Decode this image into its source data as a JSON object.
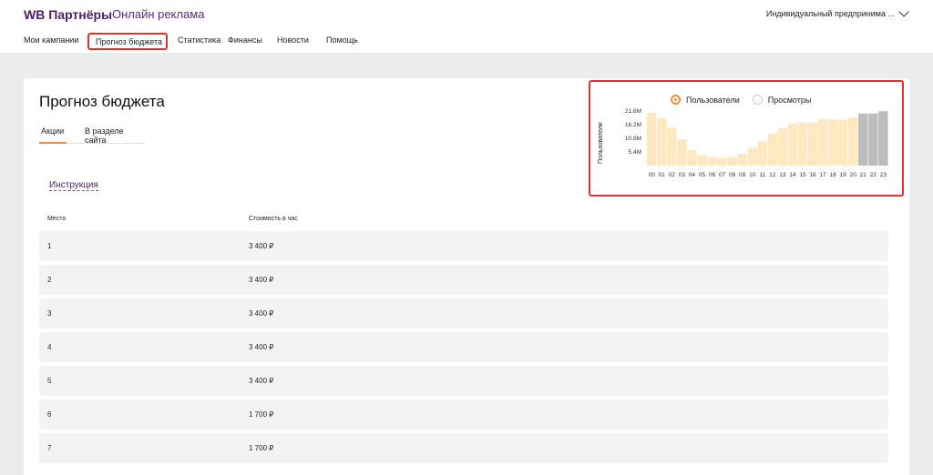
{
  "header": {
    "brand": "WB Партнёры",
    "product": "Онлайн реклама",
    "account": "Индивидуальный предпринима ..."
  },
  "nav": [
    "Мои кампании",
    "Прогноз бюджета",
    "Статистика",
    "Финансы",
    "Новости",
    "Помощь"
  ],
  "page": {
    "title": "Прогноз бюджета",
    "tabs": [
      "Акции",
      "В разделе сайта"
    ],
    "instruction_link": "Инструкция"
  },
  "table": {
    "headers": [
      "Место",
      "Стоимость в час"
    ],
    "rows": [
      [
        "1",
        "3 400 ₽"
      ],
      [
        "2",
        "3 400 ₽"
      ],
      [
        "3",
        "3 400 ₽"
      ],
      [
        "4",
        "3 400 ₽"
      ],
      [
        "5",
        "3 400 ₽"
      ],
      [
        "6",
        "1 700 ₽"
      ],
      [
        "7",
        "1 700 ₽"
      ]
    ]
  },
  "chart_options": [
    "Пользователи",
    "Просмотры"
  ],
  "colors": {
    "accent": "#f08a3c",
    "brand": "#4b1d6b",
    "highlight": "#e03131",
    "bar": "#fde8c0",
    "bar_gray": "#bdbdbd"
  },
  "chart_data": {
    "type": "bar",
    "ylabel": "Пользователи",
    "y_ticks": [
      "21.6M",
      "16.2M",
      "10.8M",
      "5.4M"
    ],
    "ylim": [
      0,
      21.6
    ],
    "categories": [
      "00",
      "01",
      "02",
      "03",
      "04",
      "05",
      "06",
      "07",
      "08",
      "09",
      "10",
      "11",
      "12",
      "13",
      "14",
      "15",
      "16",
      "17",
      "18",
      "19",
      "20",
      "21",
      "22",
      "23"
    ],
    "values": [
      20.5,
      18.5,
      14.8,
      10.3,
      6.0,
      4.1,
      3.3,
      3.0,
      3.4,
      4.6,
      6.9,
      9.4,
      12.5,
      14.6,
      16.4,
      16.8,
      16.8,
      18.1,
      18.0,
      17.9,
      18.8,
      20.3,
      20.3,
      21.2
    ],
    "highlighted_categories": [
      "21",
      "22",
      "23"
    ],
    "grid": false
  }
}
